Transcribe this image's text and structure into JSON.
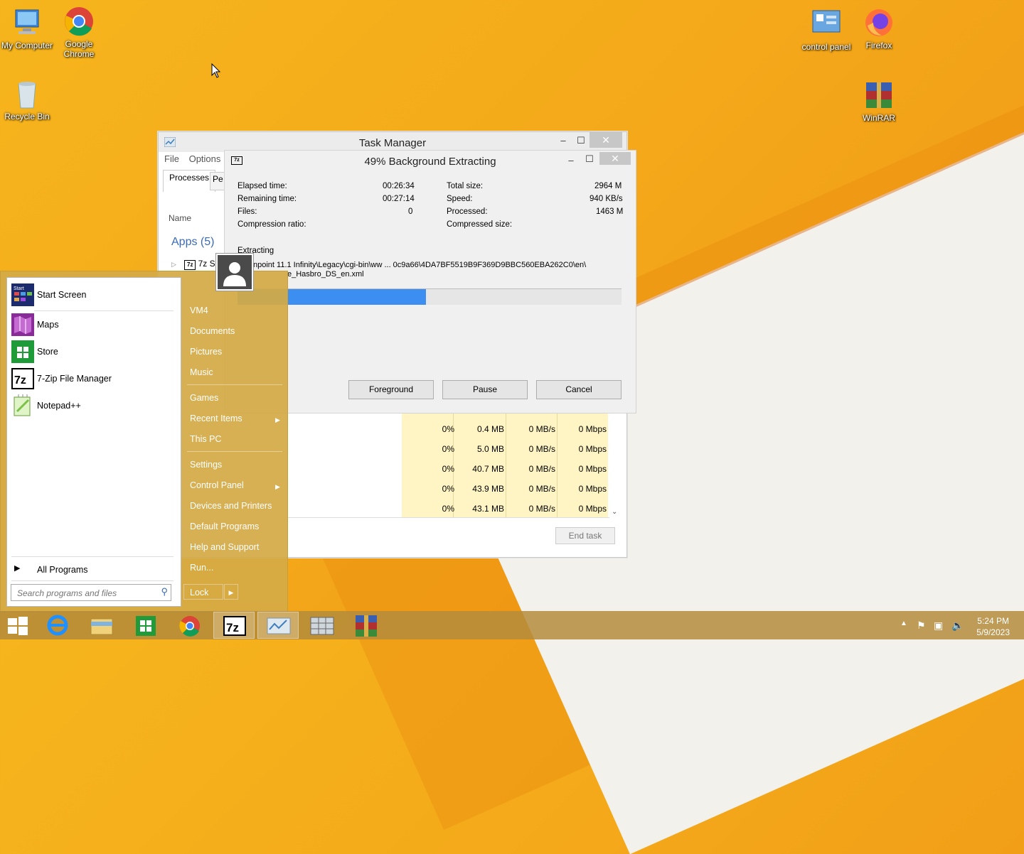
{
  "desktop": {
    "icons": [
      {
        "label": "My Computer",
        "icon": "my-computer-icon"
      },
      {
        "label": "Google Chrome",
        "icon": "chrome-icon"
      },
      {
        "label": "Recycle Bin",
        "icon": "recycle-bin-icon"
      },
      {
        "label": "control panel",
        "icon": "control-panel-icon"
      },
      {
        "label": "Firefox",
        "icon": "firefox-icon"
      },
      {
        "label": "WinRAR",
        "icon": "winrar-icon"
      }
    ]
  },
  "task_manager": {
    "title": "Task Manager",
    "menu": [
      "File",
      "Options"
    ],
    "tabs": [
      "Processes",
      "Pe"
    ],
    "column_name": "Name",
    "group": "Apps (5)",
    "first_app": "7z S",
    "rows": [
      {
        "cpu": "0%",
        "mem": "0.4 MB",
        "disk": "0 MB/s",
        "net": "0 Mbps"
      },
      {
        "cpu": "0%",
        "mem": "5.0 MB",
        "disk": "0 MB/s",
        "net": "0 Mbps"
      },
      {
        "cpu": "0%",
        "mem": "40.7 MB",
        "disk": "0 MB/s",
        "net": "0 Mbps"
      },
      {
        "cpu": "0%",
        "mem": "43.9 MB",
        "disk": "0 MB/s",
        "net": "0 Mbps"
      },
      {
        "cpu": "0%",
        "mem": "43.1 MB",
        "disk": "0 MB/s",
        "net": "0 Mbps"
      }
    ],
    "end_task": "End task"
  },
  "extract": {
    "title": "49% Background Extracting",
    "elapsed_label": "Elapsed time:",
    "elapsed": "00:26:34",
    "remaining_label": "Remaining time:",
    "remaining": "00:27:14",
    "files_label": "Files:",
    "files": "0",
    "ratio_label": "Compression ratio:",
    "total_label": "Total size:",
    "total": "2964 M",
    "speed_label": "Speed:",
    "speed": "940 KB/s",
    "processed_label": "Processed:",
    "processed": "1463 M",
    "compressed_label": "Compressed size:",
    "action": "Extracting",
    "path1": "npoint 11.1 Infinity\\Legacy\\cgi-bin\\ww ... 0c9a66\\4DA7BF5519B9F369D9BBC560EBA262C0\\en\\",
    "path2": "e_Hasbro_DS_en.xml",
    "progress": 0.49,
    "buttons": {
      "foreground": "Foreground",
      "pause": "Pause",
      "cancel": "Cancel"
    }
  },
  "start_menu": {
    "pinned": [
      {
        "label": "Start Screen",
        "icon": "start-screen-icon"
      },
      {
        "label": "Maps",
        "icon": "maps-icon"
      },
      {
        "label": "Store",
        "icon": "store-icon"
      },
      {
        "label": "7-Zip File Manager",
        "icon": "7zip-icon"
      },
      {
        "label": "Notepad++",
        "icon": "notepadpp-icon"
      }
    ],
    "all_programs": "All Programs",
    "search_placeholder": "Search programs and files",
    "right": [
      "VM4",
      "Documents",
      "Pictures",
      "Music",
      "Games",
      "Recent Items",
      "This PC",
      "Settings",
      "Control Panel",
      "Devices and Printers",
      "Default Programs",
      "Help and Support",
      "Run..."
    ],
    "lock": "Lock"
  },
  "taskbar": {
    "time": "5:24 PM",
    "date": "5/9/2023"
  },
  "colors": {
    "progress": "#3c8ff0",
    "accent": "#f4a91a"
  }
}
